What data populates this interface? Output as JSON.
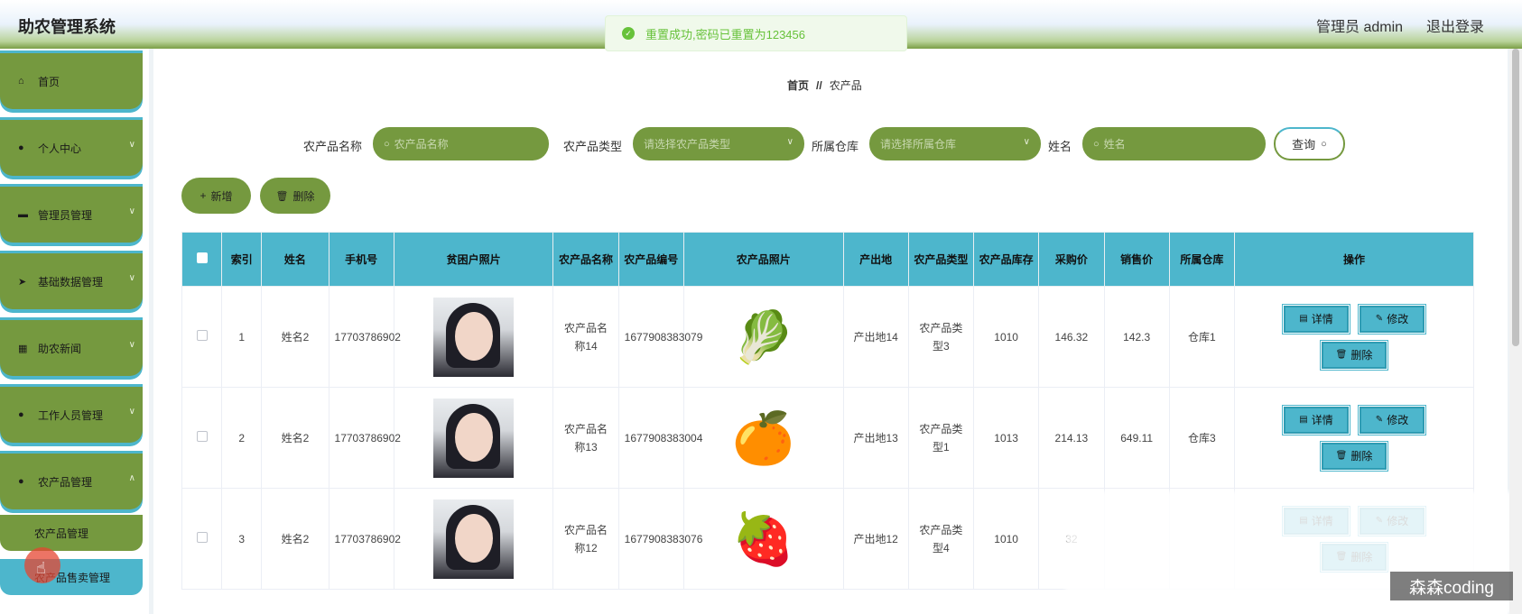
{
  "header": {
    "app_title": "助农管理系统",
    "user_label": "管理员 admin",
    "logout_label": "退出登录"
  },
  "toast": {
    "message": "重置成功,密码已重置为123456"
  },
  "sidebar": {
    "items": [
      {
        "label": "首页",
        "icon": "home-icon"
      },
      {
        "label": "个人中心",
        "icon": "user-icon"
      },
      {
        "label": "管理员管理",
        "icon": "admin-icon"
      },
      {
        "label": "基础数据管理",
        "icon": "send-icon"
      },
      {
        "label": "助农新闻",
        "icon": "grid-icon"
      },
      {
        "label": "工作人员管理",
        "icon": "pin-icon"
      },
      {
        "label": "农产品管理",
        "icon": "user-icon"
      }
    ],
    "sub_items": [
      {
        "label": "农产品管理"
      },
      {
        "label": "农产品售卖管理"
      }
    ]
  },
  "breadcrumb": {
    "home": "首页",
    "separator": "//",
    "current": "农产品"
  },
  "filters": {
    "name_label": "农产品名称",
    "name_placeholder": "农产品名称",
    "type_label": "农产品类型",
    "type_placeholder": "请选择农产品类型",
    "warehouse_label": "所属仓库",
    "warehouse_placeholder": "请选择所属仓库",
    "person_label": "姓名",
    "person_placeholder": "姓名",
    "query_label": "查询"
  },
  "actions": {
    "add_label": "新增",
    "delete_label": "删除"
  },
  "table": {
    "headers": [
      "索引",
      "姓名",
      "手机号",
      "贫困户照片",
      "农产品名称",
      "农产品编号",
      "农产品照片",
      "产出地",
      "农产品类型",
      "农产品库存",
      "采购价",
      "销售价",
      "所属仓库",
      "操作"
    ],
    "rows": [
      {
        "index": "1",
        "name": "姓名2",
        "phone": "17703786902",
        "product_name": "农产品名称14",
        "product_no": "1677908383079",
        "product_icon": "🥬",
        "origin": "产出地14",
        "type": "农产品类型3",
        "stock": "1010",
        "purchase": "146.32",
        "sale": "142.3",
        "warehouse": "仓库1"
      },
      {
        "index": "2",
        "name": "姓名2",
        "phone": "17703786902",
        "product_name": "农产品名称13",
        "product_no": "1677908383004",
        "product_icon": "🍊",
        "origin": "产出地13",
        "type": "农产品类型1",
        "stock": "1013",
        "purchase": "214.13",
        "sale": "649.11",
        "warehouse": "仓库3"
      },
      {
        "index": "3",
        "name": "姓名2",
        "phone": "17703786902",
        "product_name": "农产品名称12",
        "product_no": "1677908383076",
        "product_icon": "🍓",
        "origin": "产出地12",
        "type": "农产品类型4",
        "stock": "1010",
        "purchase": "32",
        "sale": "",
        "warehouse": ""
      }
    ],
    "op_detail": "详情",
    "op_edit": "修改",
    "op_delete": "删除"
  },
  "watermark": "森森coding",
  "colors": {
    "green": "#75993f",
    "teal": "#4db6cc",
    "success": "#67c23a"
  }
}
